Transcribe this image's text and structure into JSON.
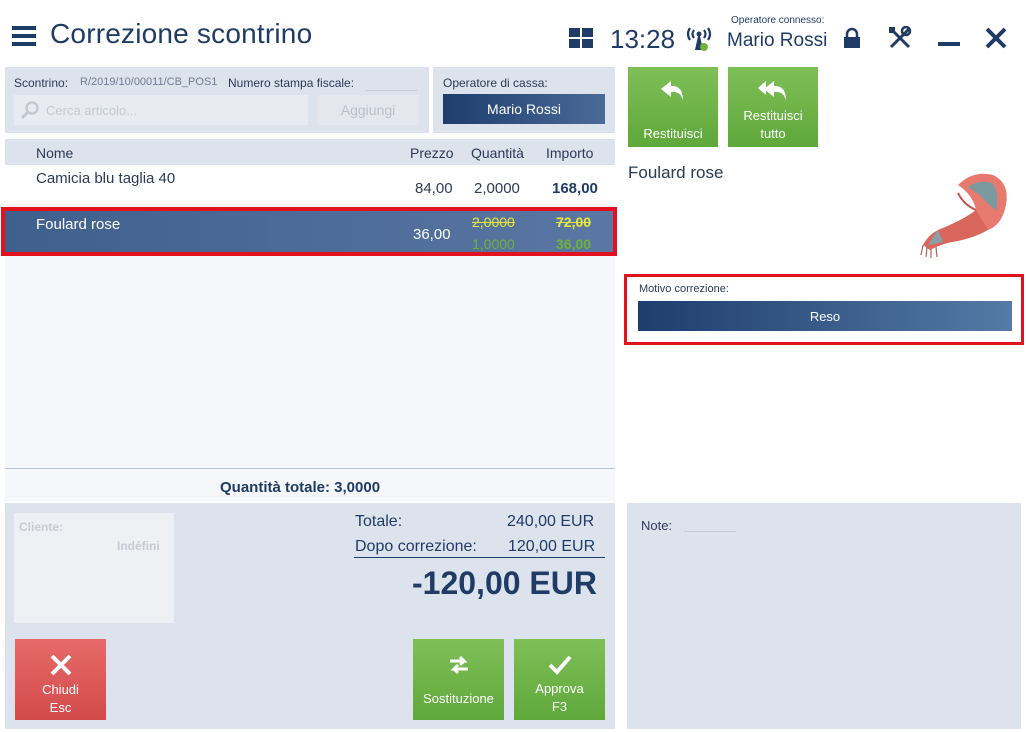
{
  "header": {
    "title": "Correzione scontrino",
    "clock": "13:28",
    "operator_label": "Operatore connesso:",
    "operator_name": "Mario Rossi"
  },
  "receipt": {
    "label": "Scontrino:",
    "number": "R/2019/10/00011/CB_POS1",
    "fiscal_label": "Numero stampa fiscale:",
    "search_placeholder": "Cerca articolo...",
    "add_label": "Aggiungi"
  },
  "cashier": {
    "label": "Operatore di cassa:",
    "name": "Mario Rossi"
  },
  "table": {
    "headers": [
      "Nome",
      "Prezzo",
      "Quantità",
      "Importo"
    ],
    "rows": [
      {
        "name": "Camicia blu taglia 40",
        "price": "84,00",
        "qty": "2,0000",
        "amount": "168,00"
      },
      {
        "name": "Foulard rose",
        "price": "36,00",
        "qty_old": "2,0000",
        "qty_new": "1,0000",
        "amount_old": "72,00",
        "amount_new": "36,00"
      }
    ],
    "total_qty": "Quantità totale:  3,0000"
  },
  "actions": {
    "restituisci": "Restituisci",
    "restituisci_tutto_1": "Restituisci",
    "restituisci_tutto_2": "tutto"
  },
  "product": {
    "name": "Foulard rose"
  },
  "motivo": {
    "label": "Motivo correzione:",
    "value": "Reso"
  },
  "summary": {
    "client_label": "Cliente:",
    "client_value": "Indéfini",
    "total_label": "Totale:",
    "total_value": "240,00 EUR",
    "after_label": "Dopo correzione:",
    "after_value": "120,00 EUR",
    "difference": "-120,00 EUR"
  },
  "buttons": {
    "close_1": "Chiudi",
    "close_2": "Esc",
    "replace": "Sostituzione",
    "approve_1": "Approva",
    "approve_2": "F3"
  },
  "notes": {
    "label": "Note:"
  },
  "colors": {
    "accent_dark": "#1f3b66",
    "selection": "#3f5f8d",
    "green": "#6fb23a",
    "red_highlight": "#e3111d",
    "panel": "#dde3ec"
  }
}
